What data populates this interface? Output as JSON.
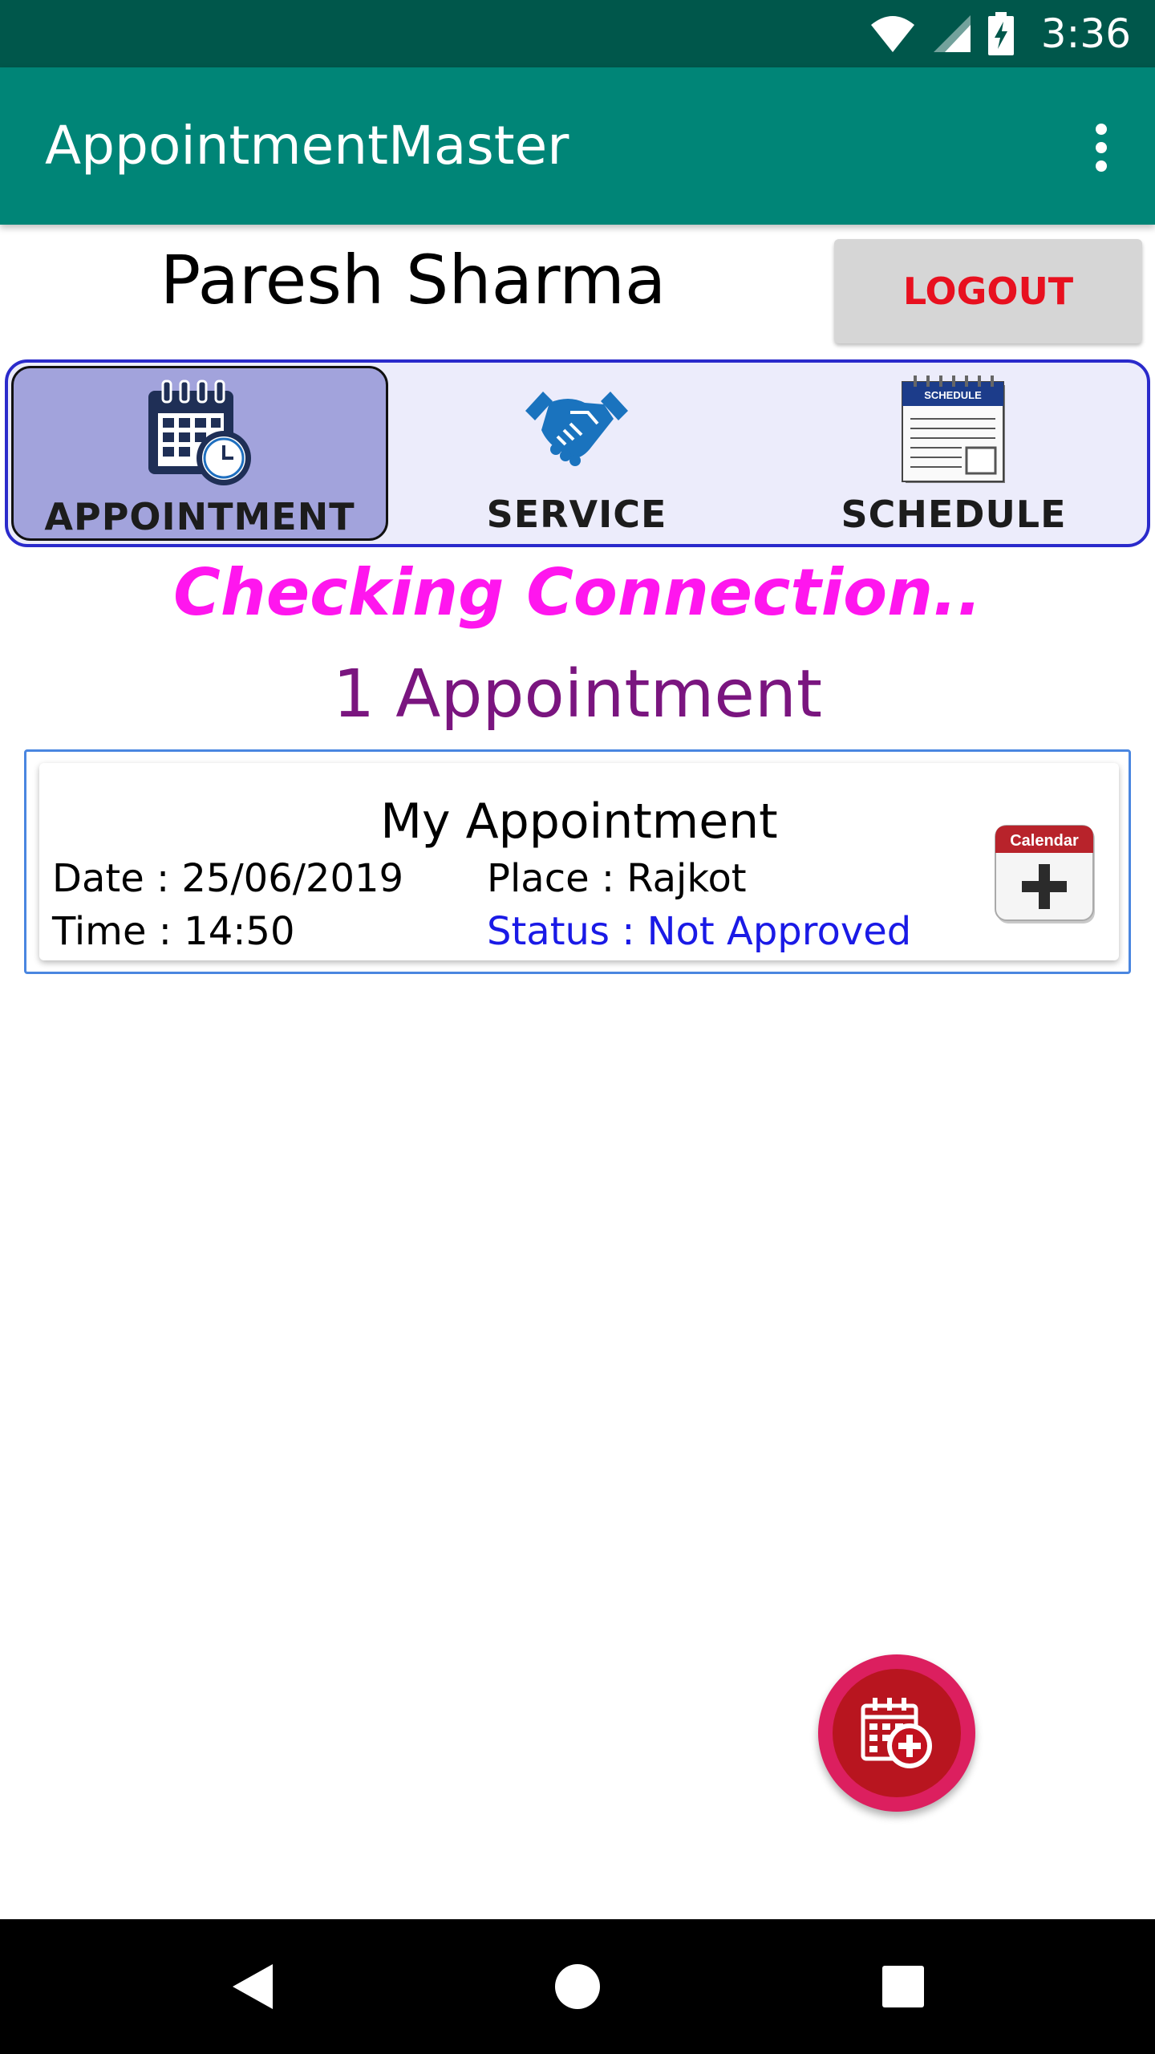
{
  "status_bar": {
    "time": "3:36"
  },
  "app_bar": {
    "title": "AppointmentMaster"
  },
  "user": {
    "name": "Paresh Sharma",
    "logout_label": "LOGOUT"
  },
  "tabs": [
    {
      "label": "APPOINTMENT",
      "active": true,
      "icon": "calendar-clock-icon"
    },
    {
      "label": "SERVICE",
      "active": false,
      "icon": "handshake-icon"
    },
    {
      "label": "SCHEDULE",
      "active": false,
      "icon": "schedule-notepad-icon",
      "icon_text": "SCHEDULE"
    }
  ],
  "connection_status": "Checking Connection..",
  "appointment_count": "1 Appointment",
  "appointments": [
    {
      "title": "My Appointment",
      "date": "Date : 25/06/2019",
      "time": "Time : 14:50",
      "place": "Place : Rajkot",
      "status": "Status : Not Approved",
      "add_to_calendar_label": "Calendar"
    }
  ],
  "colors": {
    "primary": "#008577",
    "primary_dark": "#00574b",
    "accent": "#dc1f5f",
    "logout_text": "#e8101f",
    "connection_text": "#ff16ee",
    "count_text": "#7a157f",
    "status_text": "#1a1ae6",
    "tab_active_bg": "#a2a3dc",
    "tab_bar_border": "#2a2acb"
  }
}
